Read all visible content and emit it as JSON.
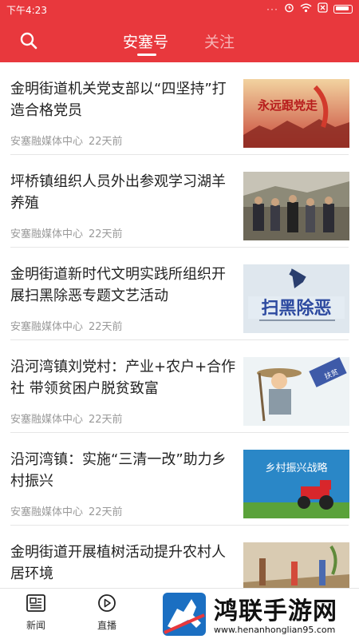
{
  "status_bar": {
    "time": "下午4:23",
    "dots": "···"
  },
  "header": {
    "tabs": [
      {
        "label": "安塞号",
        "active": true
      },
      {
        "label": "关注",
        "active": false
      }
    ],
    "accent_color": "#e8383d"
  },
  "feed": {
    "items": [
      {
        "title": "金明街道机关党支部以“四坚持”打造合格党员",
        "source": "安塞融媒体中心",
        "time": "22天前",
        "thumb_text": "永远跟党走"
      },
      {
        "title": "坪桥镇组织人员外出参观学习湖羊养殖",
        "source": "安塞融媒体中心",
        "time": "22天前",
        "thumb_text": ""
      },
      {
        "title": "金明街道新时代文明实践所组织开展扫黑除恶专题文艺活动",
        "source": "安塞融媒体中心",
        "time": "22天前",
        "thumb_text": "扫黑除恶"
      },
      {
        "title": "沿河湾镇刘党村：产业+农户+合作社 带领贫困户脱贫致富",
        "source": "安塞融媒体中心",
        "time": "22天前",
        "thumb_text": "扶贫"
      },
      {
        "title": "沿河湾镇：实施“三清一改”助力乡村振兴",
        "source": "安塞融媒体中心",
        "time": "22天前",
        "thumb_text": "乡村振兴战略"
      },
      {
        "title": "金明街道开展植树活动提升农村人居环境",
        "source": "",
        "time": "",
        "thumb_text": ""
      }
    ]
  },
  "bottom_nav": {
    "items": [
      {
        "label": "新闻",
        "icon": "newspaper-icon"
      },
      {
        "label": "直播",
        "icon": "play-circle-icon"
      }
    ]
  },
  "watermark": {
    "title": "鸿联手游网",
    "url": "www.henanhonglian95.com"
  }
}
